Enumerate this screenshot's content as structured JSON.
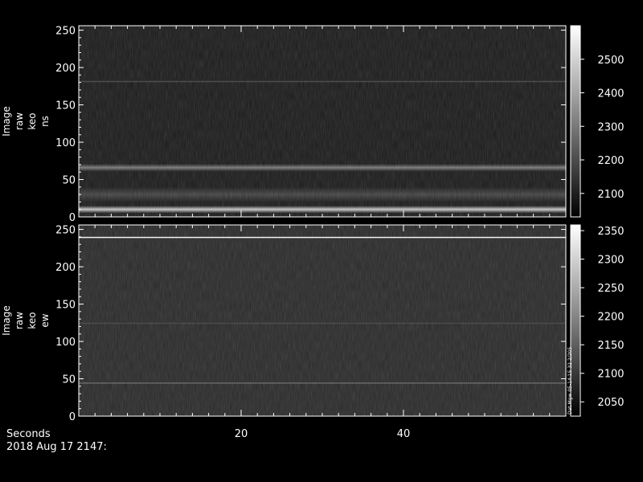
{
  "chart_data": [
    {
      "type": "heatmap",
      "panel": "top",
      "ylabel_lines": [
        "Image",
        "raw",
        "keo",
        "ns"
      ],
      "x_range": [
        0,
        60
      ],
      "x_ticks": [
        20,
        40
      ],
      "y_range": [
        0,
        256
      ],
      "y_ticks": [
        0,
        50,
        100,
        150,
        200,
        250
      ],
      "colorbar": {
        "range": [
          2030,
          2600
        ],
        "ticks": [
          2100,
          2200,
          2300,
          2400,
          2500
        ]
      },
      "bands": [
        {
          "row_center": 10,
          "width": 5,
          "intensity": 2480
        },
        {
          "row_center": 30,
          "width": 10,
          "intensity": 2180
        },
        {
          "row_center": 66,
          "width": 5,
          "intensity": 2300
        },
        {
          "row_center": 181,
          "width": 1,
          "intensity": 2180
        }
      ],
      "background_intensity": 2090
    },
    {
      "type": "heatmap",
      "panel": "bottom",
      "ylabel_lines": [
        "Image",
        "raw",
        "keo",
        "ew"
      ],
      "x_range": [
        0,
        60
      ],
      "x_ticks": [
        20,
        40
      ],
      "y_range": [
        0,
        256
      ],
      "y_ticks": [
        0,
        50,
        100,
        150,
        200,
        250
      ],
      "colorbar": {
        "range": [
          2025,
          2360
        ],
        "ticks": [
          2050,
          2100,
          2150,
          2200,
          2250,
          2300,
          2350
        ],
        "side_label": "Dat.Mgw 05-14:15 32 2/205"
      },
      "bands": [
        {
          "row_center": 239,
          "width": 1,
          "intensity": 2350
        },
        {
          "row_center": 44,
          "width": 1,
          "intensity": 2150
        },
        {
          "row_center": 124,
          "width": 1,
          "intensity": 2110
        }
      ],
      "background_intensity": 2080
    }
  ],
  "footer": {
    "xlabel": "Seconds",
    "timestamp": "2018 Aug 17 2147:"
  }
}
